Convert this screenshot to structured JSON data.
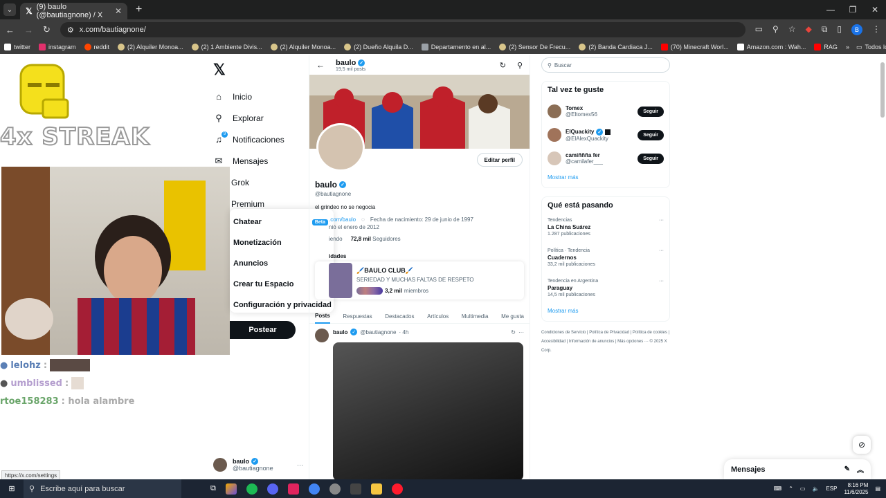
{
  "browser": {
    "tab_title": "(9) baulo (@bautiagnone) / X",
    "url": "x.com/bautiagnone/",
    "status_url": "https://x.com/settings",
    "bookmarks": [
      {
        "label": "twitter",
        "color": "#ffffff"
      },
      {
        "label": "instagram",
        "color": "#e1306c"
      },
      {
        "label": "reddit",
        "color": "#ff4500"
      },
      {
        "label": "(2) Alquiler Monoa...",
        "color": "#d8c58a"
      },
      {
        "label": "(2) 1 Ambiente Divis...",
        "color": "#d8c58a"
      },
      {
        "label": "(2) Alquiler Monoa...",
        "color": "#d8c58a"
      },
      {
        "label": "(2) Dueño Alquila D...",
        "color": "#d8c58a"
      },
      {
        "label": "Departamento en al...",
        "color": "#9aa0a6"
      },
      {
        "label": "(2) Sensor De Frecu...",
        "color": "#d8c58a"
      },
      {
        "label": "(2) Banda Cardiaca J...",
        "color": "#d8c58a"
      },
      {
        "label": "(70) Minecraft Worl...",
        "color": "#ff0000"
      },
      {
        "label": "Amazon.com : Wah...",
        "color": "#ffffff"
      },
      {
        "label": "RAG",
        "color": "#ff0000"
      }
    ],
    "bookmarks_overflow": "»",
    "all_bookmarks": "Todos los marcadores"
  },
  "stream": {
    "streak": "4x STREAK",
    "chat": [
      {
        "user": "lelohz",
        "color": "#5b7fb5",
        "message": ":"
      },
      {
        "user": "umblissed",
        "color": "#b59fcf",
        "message": ":"
      },
      {
        "user": "rtoe158283",
        "color": "#6aa56a",
        "message": ": hola alambre"
      }
    ]
  },
  "nav": {
    "items": [
      {
        "label": "Inicio",
        "icon": "home-icon",
        "glyph": "⌂"
      },
      {
        "label": "Explorar",
        "icon": "search-icon",
        "glyph": "⚲"
      },
      {
        "label": "Notificaciones",
        "icon": "bell-icon",
        "glyph": "🔔"
      },
      {
        "label": "Mensajes",
        "icon": "mail-icon",
        "glyph": "✉"
      },
      {
        "label": "Grok",
        "icon": "grok-icon",
        "glyph": ""
      },
      {
        "label": "Premium",
        "icon": "premium-icon",
        "glyph": ""
      }
    ],
    "notification_badge": "9",
    "more_menu": [
      {
        "label": "Chatear",
        "badge": "Beta"
      },
      {
        "label": "Monetización"
      },
      {
        "label": "Anuncios"
      },
      {
        "label": "Crear tu Espacio"
      },
      {
        "label": "Configuración y privacidad"
      }
    ],
    "post_button": "Postear",
    "account": {
      "name": "baulo",
      "handle": "@bautiagnone",
      "more": "···"
    }
  },
  "profile": {
    "name": "baulo",
    "posts_count": "19,5 mil posts",
    "handle": "@bautiagnone",
    "edit_button": "Editar perfil",
    "bio": "el grindeo no se negocia",
    "link": ".com/baulo",
    "birthday": "Fecha de nacimiento: 29 de junio de 1997",
    "joined": "nió el enero de 2012",
    "following_label": "iendo",
    "followers_count": "72,8 mil",
    "followers_label": "Seguidores",
    "communities_heading": "idades",
    "community": {
      "name": "🖌️BAULO CLUB🖌️",
      "description": "SERIEDAD Y MUCHAS FALTAS DE RESPETO",
      "members_count": "3,2 mil",
      "members_label": "miembros"
    },
    "tabs": [
      "Posts",
      "Respuestas",
      "Destacados",
      "Artículos",
      "Multimedia",
      "Me gusta"
    ],
    "tweet": {
      "name": "baulo",
      "handle": "@bautiagnone",
      "time": "· 4h"
    }
  },
  "sidebar": {
    "search_placeholder": "Buscar",
    "who_to_follow_title": "Tal vez te guste",
    "who_to_follow": [
      {
        "name": "Tomex",
        "handle": "@Eltomex56",
        "button": "Seguir"
      },
      {
        "name": "ElQuackity",
        "handle": "@ElAlexQuackity",
        "button": "Seguir"
      },
      {
        "name": "camiññña fer",
        "handle": "@camilafer___",
        "button": "Seguir"
      }
    ],
    "show_more": "Mostrar más",
    "trends_title": "Qué está pasando",
    "trends": [
      {
        "context": "Tendencias",
        "name": "La China Suárez",
        "count": "1.287 publicaciones"
      },
      {
        "context": "Política · Tendencia",
        "name": "Cuadernos",
        "count": "33,2 mil publicaciones"
      },
      {
        "context": "Tendencia en Argentina",
        "name": "Paraguay",
        "count": "14,5 mil publicaciones"
      }
    ],
    "trends_show_more": "Mostrar más",
    "footer": "Condiciones de Servicio | Política de Privacidad | Política de cookies | Accesibilidad | Información de anuncios | Más opciones ··· © 2025 X Corp."
  },
  "messages_drawer": "Mensajes",
  "taskbar": {
    "search_placeholder": "Escribe aquí para buscar",
    "language": "ESP",
    "time": "8:16 PM",
    "date": "11/6/2025",
    "apps": [
      "#f2a900",
      "#1db954",
      "#5865f2",
      "#e0245e",
      "#4285f4",
      "#888888",
      "#444444",
      "#f4c542",
      "#ff1b2d"
    ]
  }
}
